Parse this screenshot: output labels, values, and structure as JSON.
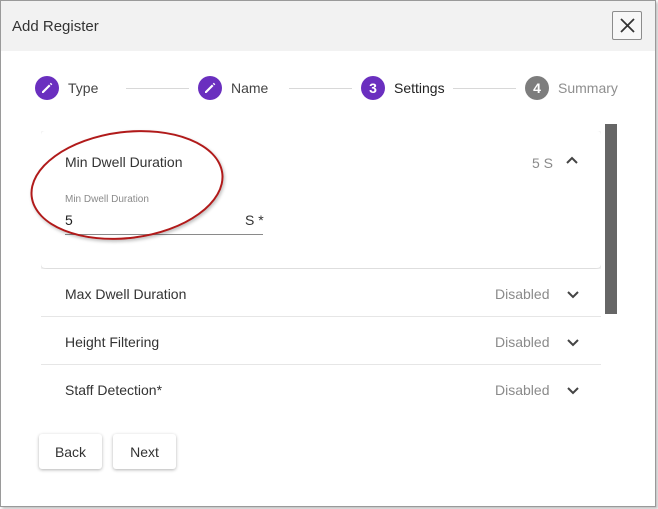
{
  "dialog": {
    "title": "Add Register",
    "close_icon": "close-icon"
  },
  "stepper": {
    "steps": [
      {
        "marker": "pencil-icon",
        "label": "Type",
        "state": "completed"
      },
      {
        "marker": "pencil-icon",
        "label": "Name",
        "state": "completed"
      },
      {
        "marker": "3",
        "label": "Settings",
        "state": "active"
      },
      {
        "marker": "4",
        "label": "Summary",
        "state": "upcoming"
      }
    ]
  },
  "panels": {
    "min_dwell": {
      "title": "Min Dwell Duration",
      "value": "5 S",
      "field_label": "Min Dwell Duration",
      "field_value": "5",
      "field_suffix": "S *",
      "expanded": true
    },
    "max_dwell": {
      "title": "Max Dwell Duration",
      "value": "Disabled"
    },
    "height_filtering": {
      "title": "Height Filtering",
      "value": "Disabled"
    },
    "staff_detection": {
      "title": "Staff Detection*",
      "value": "Disabled"
    }
  },
  "buttons": {
    "back": "Back",
    "next": "Next"
  },
  "colors": {
    "accent": "#6a2fbf",
    "inactive_step": "#7d7d7d",
    "annotation": "#b11a1a"
  }
}
